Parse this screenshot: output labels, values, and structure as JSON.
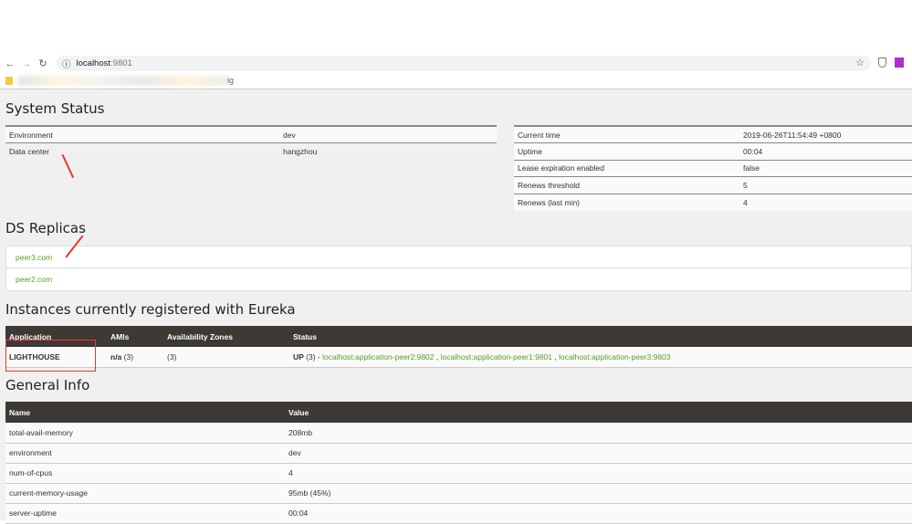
{
  "browser": {
    "host": "localhost",
    "port": ":9801",
    "bookmark_tail": "ig"
  },
  "system_status": {
    "title": "System Status",
    "left": [
      [
        "Environment",
        "dev"
      ],
      [
        "Data center",
        "hangzhou"
      ]
    ],
    "right": [
      [
        "Current time",
        "2019-06-26T11:54:49 +0800"
      ],
      [
        "Uptime",
        "00:04"
      ],
      [
        "Lease expiration enabled",
        "false"
      ],
      [
        "Renews threshold",
        "5"
      ],
      [
        "Renews (last min)",
        "4"
      ]
    ]
  },
  "replicas": {
    "title": "DS Replicas",
    "items": [
      "peer3.com",
      "peer2.com"
    ]
  },
  "instances": {
    "title": "Instances currently registered with Eureka",
    "headers": [
      "Application",
      "AMIs",
      "Availability Zones",
      "Status"
    ],
    "row": {
      "app": "LIGHTHOUSE",
      "amis": "n/a",
      "amis_count": " (3)",
      "zones": "(3)",
      "status": "UP",
      "status_count": " (3) - ",
      "links": [
        "localhost:application-peer2:9802",
        "localhost:application-peer1:9801",
        "localhost:application-peer3:9803"
      ],
      "sep": " , "
    }
  },
  "general": {
    "title": "General Info",
    "headers": [
      "Name",
      "Value"
    ],
    "rows": [
      [
        "total-avail-memory",
        "208mb"
      ],
      [
        "environment",
        "dev"
      ],
      [
        "num-of-cpus",
        "4"
      ],
      [
        "current-memory-usage",
        "95mb (45%)"
      ],
      [
        "server-uptime",
        "00:04"
      ]
    ]
  }
}
